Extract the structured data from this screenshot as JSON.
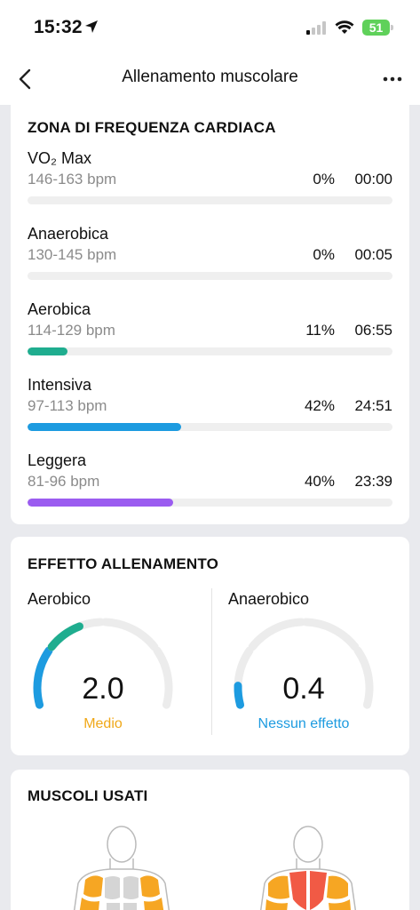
{
  "status": {
    "time": "15:32",
    "battery": "51"
  },
  "nav": {
    "title": "Allenamento muscolare"
  },
  "heart_zones": {
    "title": "ZONA DI FREQUENZA CARDIACA",
    "zones": [
      {
        "name": "VO₂ Max",
        "range": "146-163 bpm",
        "percent": "0%",
        "time": "00:00",
        "fraction": 0,
        "color": "#cccccc"
      },
      {
        "name": "Anaerobica",
        "range": "130-145 bpm",
        "percent": "0%",
        "time": "00:05",
        "fraction": 0,
        "color": "#cccccc"
      },
      {
        "name": "Aerobica",
        "range": "114-129 bpm",
        "percent": "11%",
        "time": "06:55",
        "fraction": 0.11,
        "color": "#1fad8f"
      },
      {
        "name": "Intensiva",
        "range": "97-113 bpm",
        "percent": "42%",
        "time": "24:51",
        "fraction": 0.42,
        "color": "#1d9be0"
      },
      {
        "name": "Leggera",
        "range": "81-96 bpm",
        "percent": "40%",
        "time": "23:39",
        "fraction": 0.4,
        "color": "#9b5cf0"
      }
    ]
  },
  "training_effect": {
    "title": "EFFETTO ALLENAMENTO",
    "aerobic": {
      "label": "Aerobico",
      "value": "2.0",
      "level": "Medio",
      "level_color": "#f0a818",
      "fraction": 0.4
    },
    "anaerobic": {
      "label": "Anaerobico",
      "value": "0.4",
      "level": "Nessun effetto",
      "level_color": "#1d9be0",
      "fraction": 0.08
    }
  },
  "muscles": {
    "title": "MUSCOLI USATI",
    "colors": {
      "primary": "#f15a45",
      "secondary": "#f6a623",
      "inactive": "#d5d5d5"
    }
  }
}
